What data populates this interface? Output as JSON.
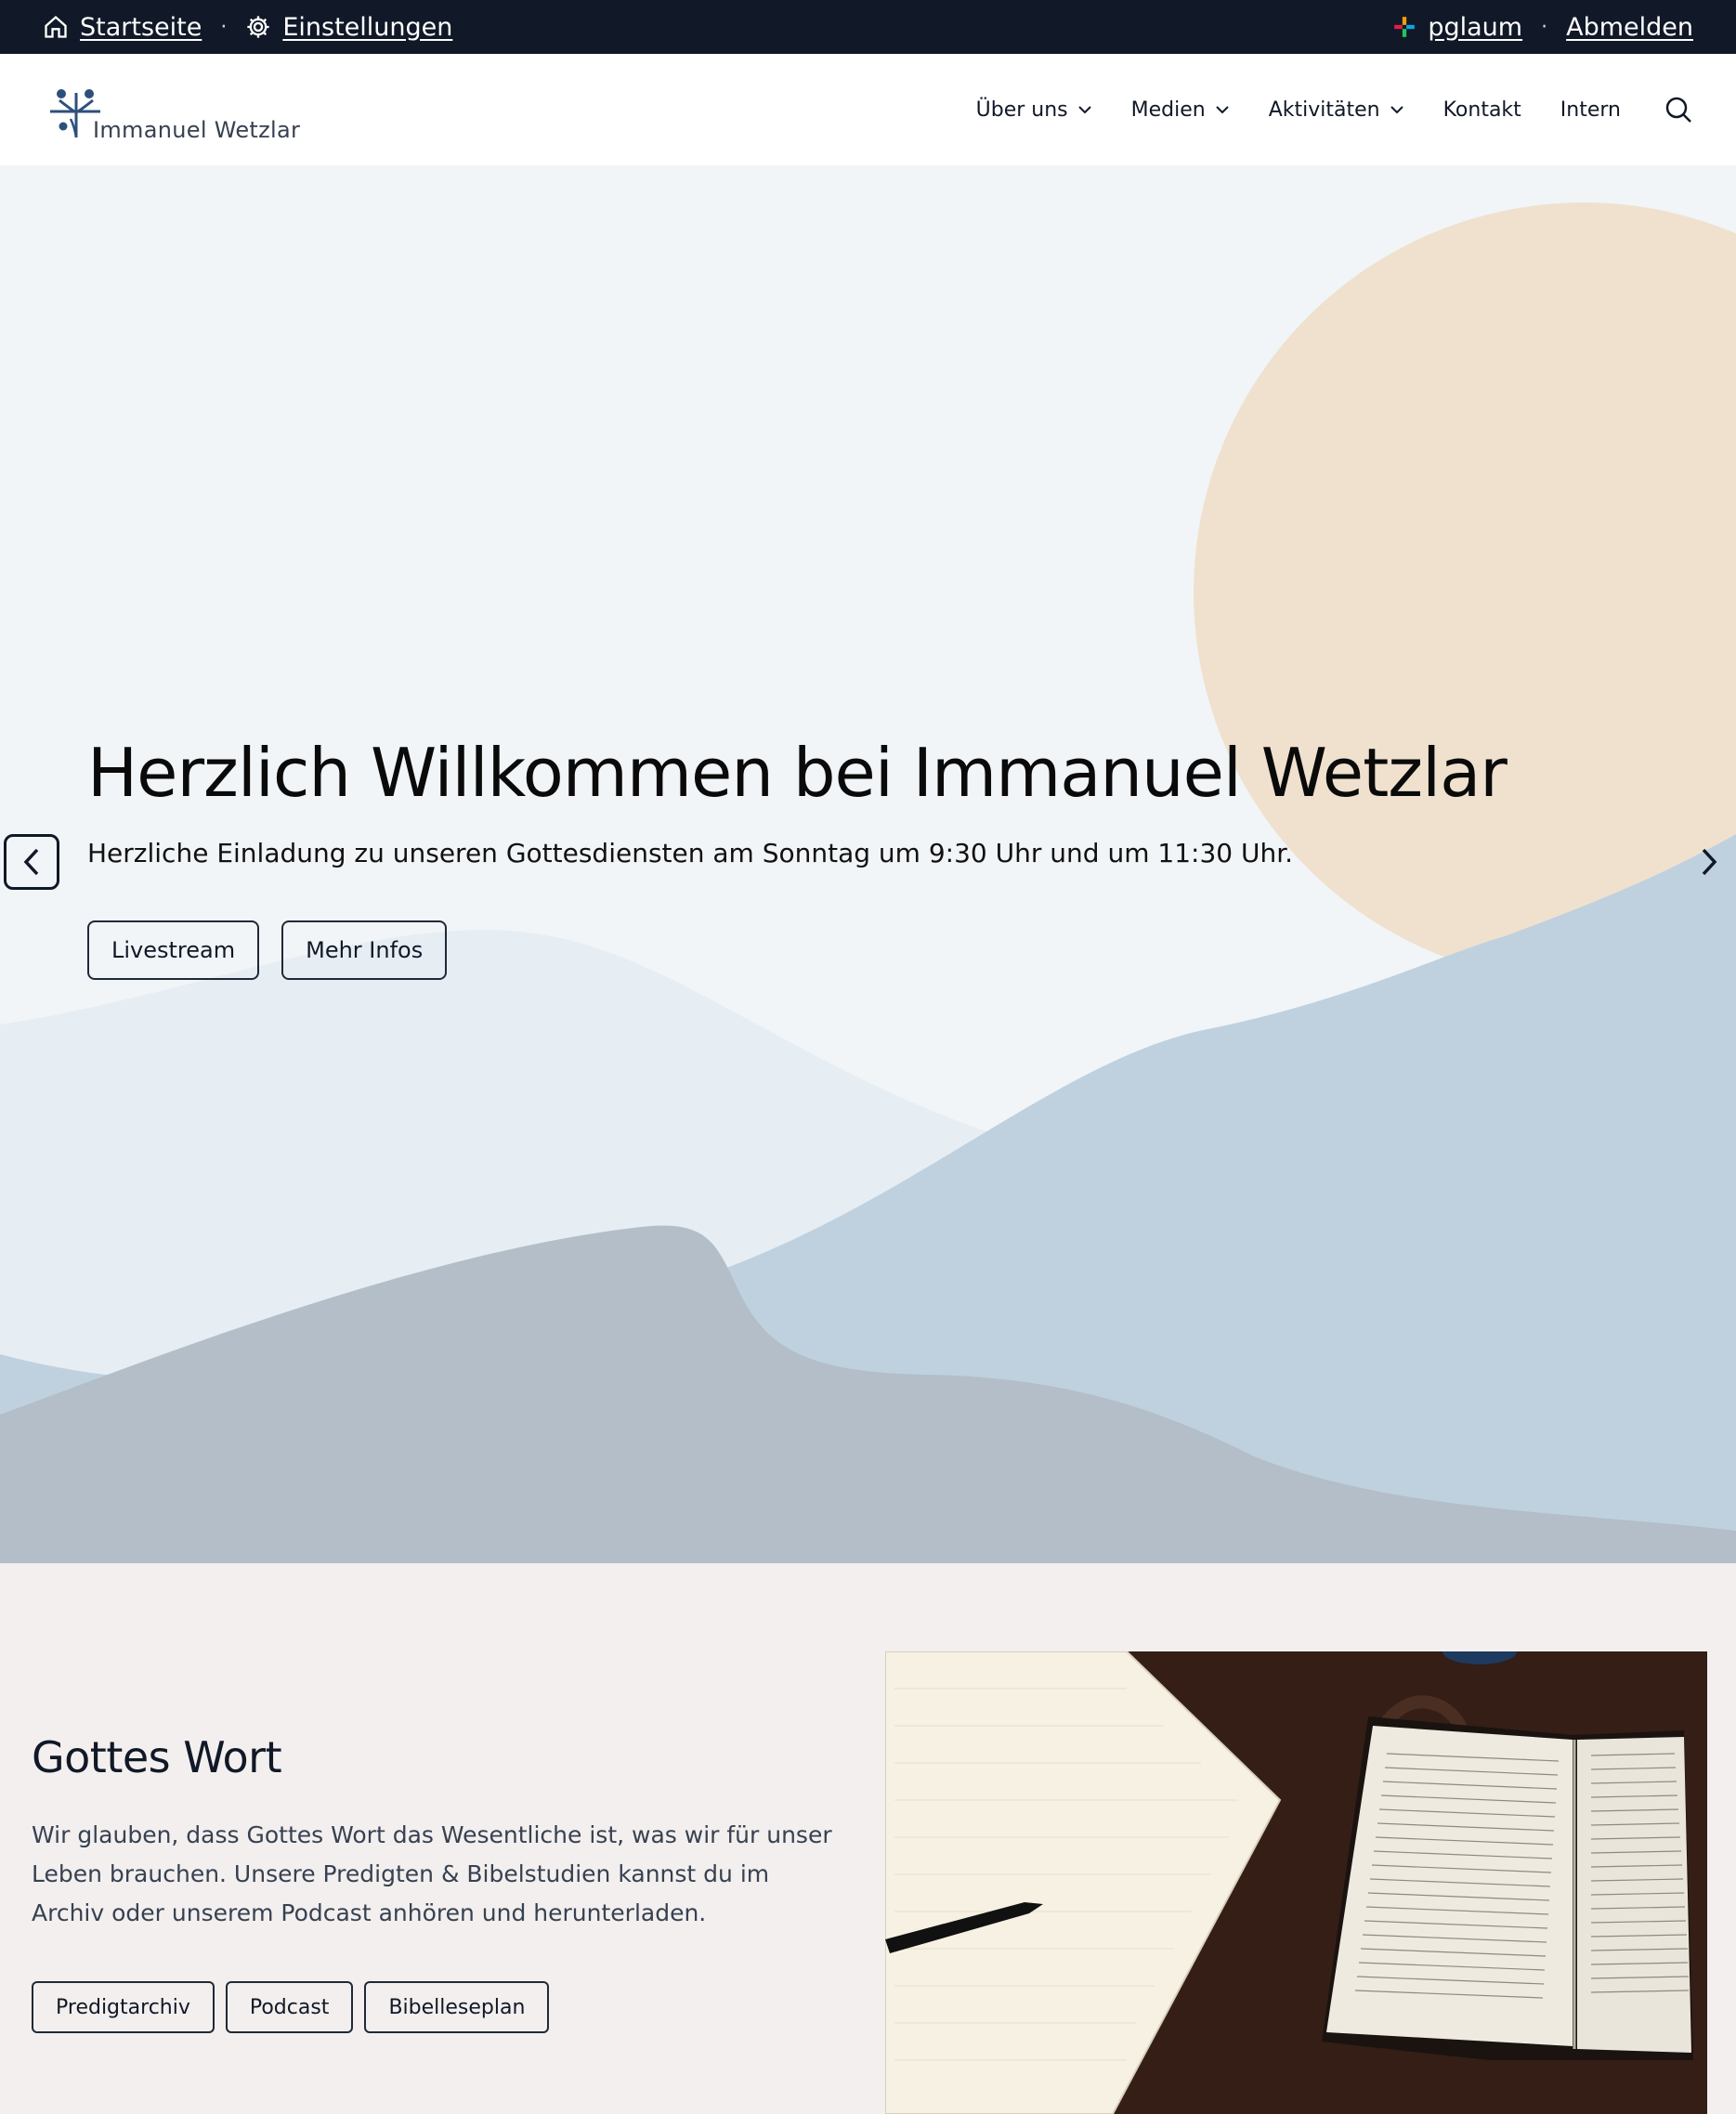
{
  "adminbar": {
    "home_label": "Startseite",
    "settings_label": "Einstellungen",
    "separator": "·",
    "user_label": "pglaum",
    "logout_label": "Abmelden"
  },
  "header": {
    "logo_text": "Immanuel Wetzlar",
    "nav": [
      {
        "label": "Über uns",
        "has_dropdown": true
      },
      {
        "label": "Medien",
        "has_dropdown": true
      },
      {
        "label": "Aktivitäten",
        "has_dropdown": true
      },
      {
        "label": "Kontakt",
        "has_dropdown": false
      },
      {
        "label": "Intern",
        "has_dropdown": false
      }
    ]
  },
  "hero": {
    "title": "Herzlich Willkommen bei Immanuel Wetzlar",
    "subtitle": "Herzliche Einladung zu unseren Gottesdiensten am Sonntag um 9:30 Uhr und um 11:30 Uhr.",
    "buttons": [
      "Livestream",
      "Mehr Infos"
    ],
    "colors": {
      "background": "#f1f5f8",
      "sun": "#f0e1cf",
      "hill_light": "#e6edf3",
      "hill_blue": "#bfd1df",
      "hill_gray": "#b3bec8"
    }
  },
  "section": {
    "title": "Gottes Wort",
    "text": "Wir glauben, dass Gottes Wort das Wesentliche ist, was wir für unser Leben brauchen. Unsere Predigten & Bibelstudien kannst du im Archiv oder unserem Podcast anhören und herunterladen.",
    "buttons": [
      "Predigtarchiv",
      "Podcast",
      "Bibelleseplan"
    ]
  },
  "colors": {
    "adminbar_bg": "#111827",
    "text_dark": "#111827",
    "section_bg": "#f2efee",
    "logo_blue": "#2d4f7c"
  }
}
